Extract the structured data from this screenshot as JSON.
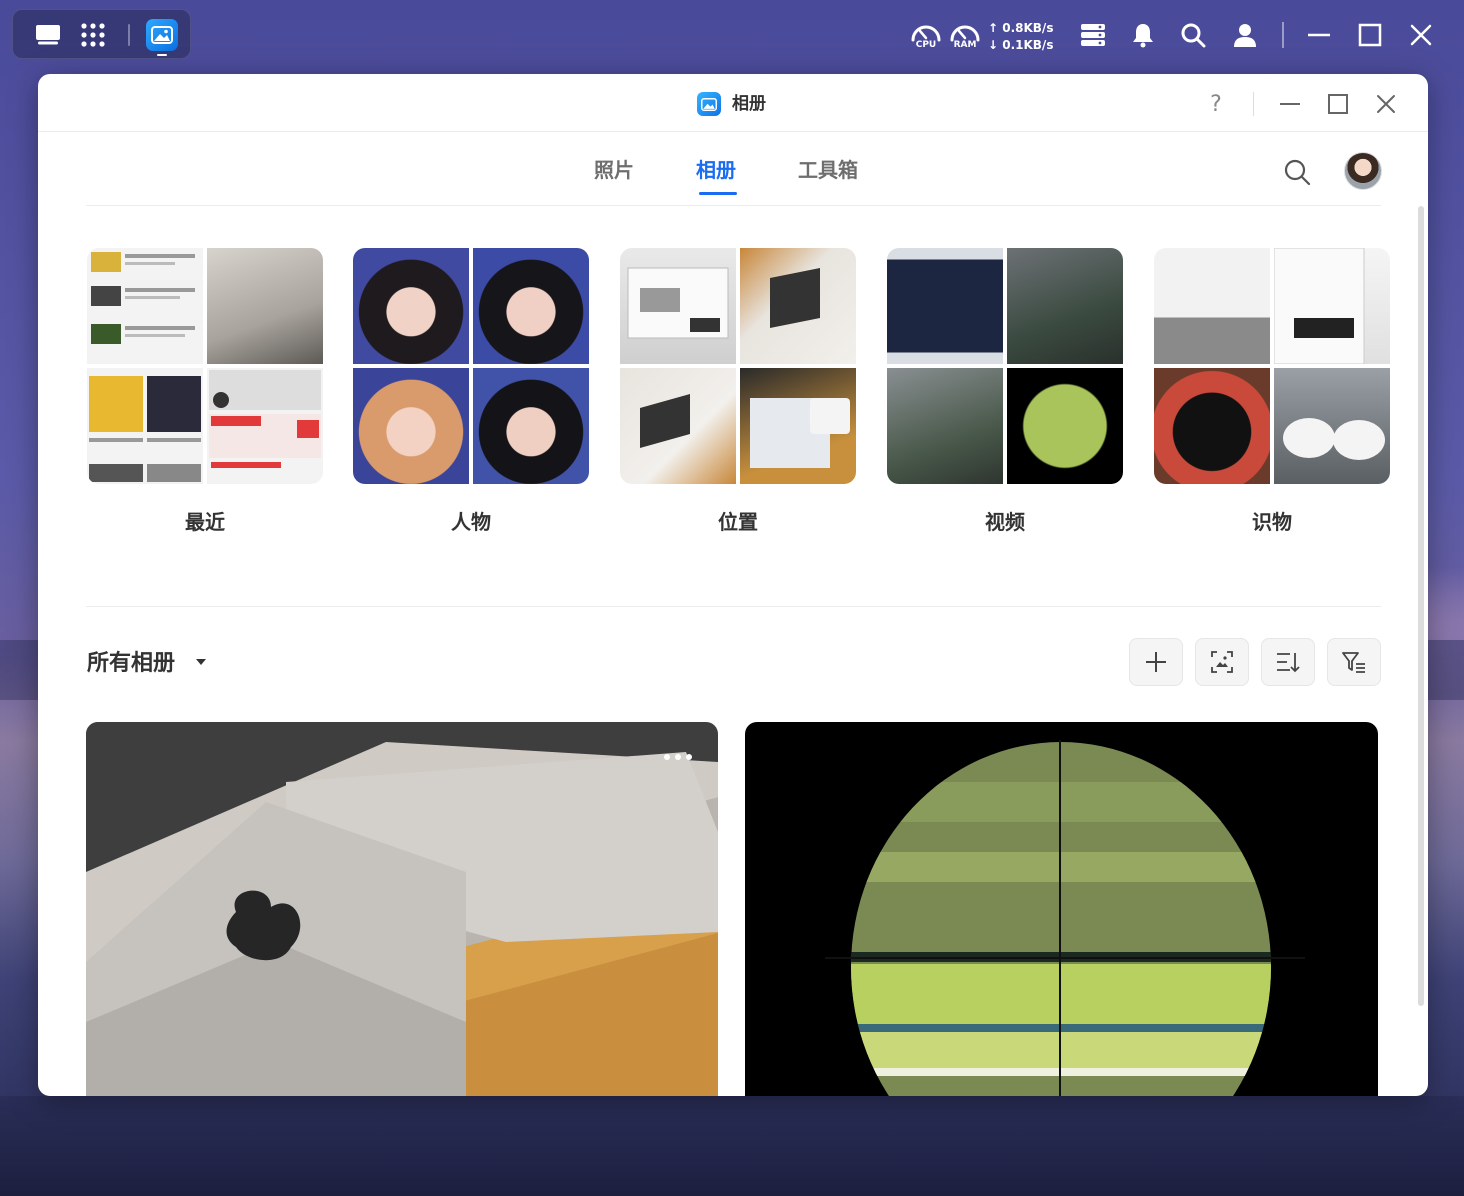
{
  "desktop": {
    "taskbar": {
      "desktop_icon": "desktop-icon",
      "apps_icon": "app-grid-icon",
      "active_app_icon": "photos-app-icon"
    },
    "monitor": {
      "cpu_label": "CPU",
      "ram_label": "RAM",
      "upload": "↑ 0.8KB/s",
      "download": "↓ 0.1KB/s"
    },
    "system_icons": [
      "stack-icon",
      "bell-icon",
      "search-icon",
      "user-icon"
    ],
    "window_controls": [
      "minimize-icon",
      "maximize-icon",
      "close-icon"
    ]
  },
  "window": {
    "title": "相册",
    "help_label": "?",
    "tabs": [
      {
        "label": "照片",
        "active": false
      },
      {
        "label": "相册",
        "active": true
      },
      {
        "label": "工具箱",
        "active": false
      }
    ],
    "accent_color": "#1a6cf0"
  },
  "smart_albums": [
    {
      "label": "最近"
    },
    {
      "label": "人物"
    },
    {
      "label": "位置"
    },
    {
      "label": "视频"
    },
    {
      "label": "识物"
    }
  ],
  "all_albums": {
    "title": "所有相册",
    "tools": [
      "add-icon",
      "image-scan-icon",
      "sort-icon",
      "filter-icon"
    ],
    "cards": [
      {
        "name": "album-card-1",
        "has_menu": true
      },
      {
        "name": "album-card-2",
        "has_menu": false
      }
    ]
  }
}
